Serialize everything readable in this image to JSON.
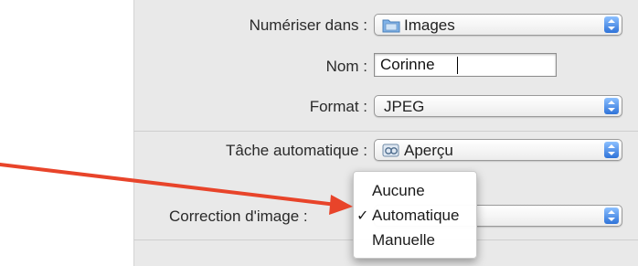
{
  "form": {
    "scan_to": {
      "label": "Numériser dans :",
      "value": "Images",
      "icon": "folder-icon"
    },
    "name": {
      "label": "Nom :",
      "value": "Corinne"
    },
    "format": {
      "label": "Format :",
      "value": "JPEG"
    },
    "auto_task": {
      "label": "Tâche automatique :",
      "value": "Aperçu",
      "icon": "preview-app-icon"
    },
    "image_correction": {
      "label": "Correction d'image :"
    }
  },
  "correction_menu": {
    "items": [
      {
        "label": "Aucune",
        "checked": false
      },
      {
        "label": "Automatique",
        "checked": true
      },
      {
        "label": "Manuelle",
        "checked": false
      }
    ],
    "checkmark": "✓"
  },
  "colors": {
    "accent": "#2f73d8",
    "arrow": "#e8442a",
    "panel": "#e9e9e9"
  }
}
